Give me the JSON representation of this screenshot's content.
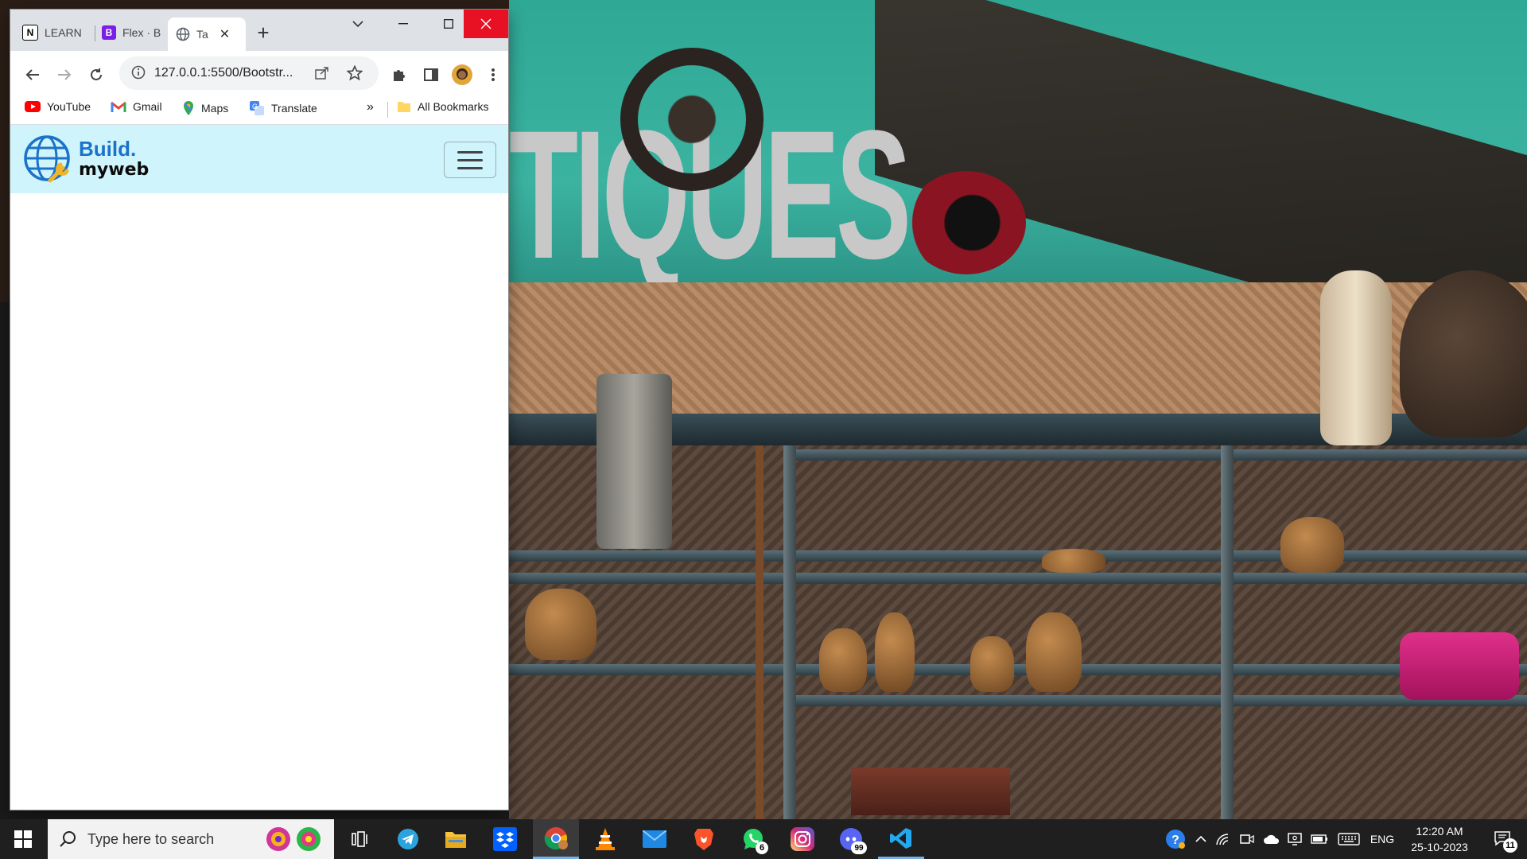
{
  "browser": {
    "tabs": [
      {
        "title": "LEARN",
        "favicon": "N"
      },
      {
        "title": "Flex · B",
        "favicon": "B"
      },
      {
        "title": "Ta",
        "favicon": "globe"
      }
    ],
    "new_tab_label": "+",
    "url": "127.0.0.1:5500/Bootstr...",
    "bookmarks": [
      {
        "label": "YouTube"
      },
      {
        "label": "Gmail"
      },
      {
        "label": "Maps"
      },
      {
        "label": "Translate"
      }
    ],
    "bookmarks_overflow": "»",
    "all_bookmarks": "All Bookmarks"
  },
  "site": {
    "brand_top": "Build.",
    "brand_bottom": "myweb",
    "nav_bg": "#cff4fc",
    "brand_color": "#1a73c9"
  },
  "wallpaper": {
    "sign_text": "TIQUES"
  },
  "taskbar": {
    "search_placeholder": "Type here to search",
    "whatsapp_badge": "6",
    "discord_badge": "99",
    "language": "ENG",
    "time": "12:20 AM",
    "date": "25-10-2023",
    "notifications_count": "11"
  },
  "colors": {
    "accent_close": "#e81123",
    "taskbar_bg": "#1f1f1f"
  }
}
